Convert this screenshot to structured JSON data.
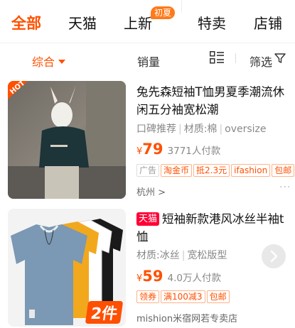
{
  "tabs": [
    {
      "label": "全部"
    },
    {
      "label": "天猫"
    },
    {
      "label": "上新",
      "badge": "初夏"
    },
    {
      "label": "特卖"
    },
    {
      "label": "店铺"
    }
  ],
  "sort": {
    "default_label": "综合",
    "sales_label": "销量",
    "filter_label": "筛选"
  },
  "products": [
    {
      "image_badge": "HOT",
      "title": "兔先森短袖T恤男夏季潮流休闲五分袖宽松潮",
      "attrs": [
        "口碑推荐",
        "材质:棉",
        "oversize"
      ],
      "currency": "¥",
      "price": "79",
      "sold": "3771人付款",
      "tags": [
        "广告",
        "淘金币",
        "抵2.3元",
        "ifashion",
        "包邮"
      ],
      "location": "杭州 >",
      "more": "···"
    },
    {
      "store_tag": "天猫",
      "title": "短袖新款港风冰丝半袖t恤",
      "attrs": [
        "材质:冰丝",
        "宽松版型"
      ],
      "currency": "¥",
      "price": "59",
      "sold": "4.0万人付款",
      "tags": [
        "领券",
        "满100减3",
        "包邮"
      ],
      "shop": "mishion米宿网若专卖店",
      "image_badge": "2件"
    }
  ],
  "colors": {
    "accent": "#ff5000",
    "tmall": "#ff0036"
  }
}
